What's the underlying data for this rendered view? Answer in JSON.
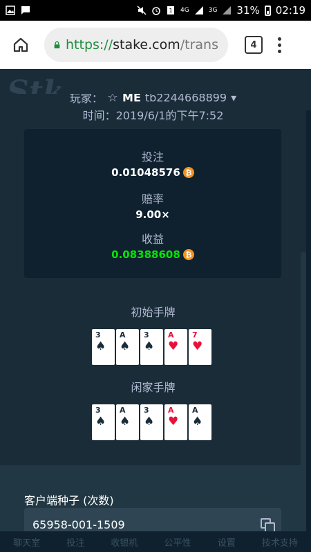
{
  "statusbar": {
    "network_4g": "4G",
    "network_3g": "3G",
    "battery": "31%",
    "time": "02:19",
    "icons": [
      "image-icon",
      "message-icon",
      "mute-icon",
      "alarm-icon",
      "notification-icon",
      "signal-icon",
      "battery-icon"
    ]
  },
  "browser": {
    "url_scheme": "https://",
    "url_host": "stake.com",
    "url_path": "/trans",
    "tab_count": "4"
  },
  "bet": {
    "player_label": "玩家：",
    "player_name": "ME",
    "player_id": "tb2244668899",
    "time_text": "时间：2019/6/1的下午7:52",
    "wager_label": "投注",
    "wager_value": "0.01048576",
    "odds_label": "赔率",
    "odds_value": "9.00×",
    "profit_label": "收益",
    "profit_value": "0.08388608",
    "currency_symbol": "₿",
    "initial_hand_title": "初始手牌",
    "initial_hand": [
      {
        "rank": "3",
        "suit": "♠",
        "color": "black"
      },
      {
        "rank": "A",
        "suit": "♠",
        "color": "black"
      },
      {
        "rank": "3",
        "suit": "♠",
        "color": "black"
      },
      {
        "rank": "A",
        "suit": "♥",
        "color": "red"
      },
      {
        "rank": "7",
        "suit": "♥",
        "color": "red"
      }
    ],
    "player_hand_title": "闲家手牌",
    "player_hand": [
      {
        "rank": "3",
        "suit": "♠",
        "color": "black"
      },
      {
        "rank": "A",
        "suit": "♠",
        "color": "black"
      },
      {
        "rank": "3",
        "suit": "♠",
        "color": "black"
      },
      {
        "rank": "A",
        "suit": "♥",
        "color": "red"
      },
      {
        "rank": "A",
        "suit": "♠",
        "color": "black"
      }
    ],
    "client_seed_label": "客户端种子 (次数)",
    "client_seed_value": "65958-001-1509"
  },
  "bottom_nav": [
    "聊天室",
    "投注",
    "收银机",
    "公平性",
    "设置",
    "技术支持"
  ],
  "colors": {
    "bg_dark": "#0f212e",
    "panel": "#1a2c38",
    "profit_green": "#00e701",
    "btc_orange": "#f7931a",
    "card_red": "#e9113c"
  }
}
